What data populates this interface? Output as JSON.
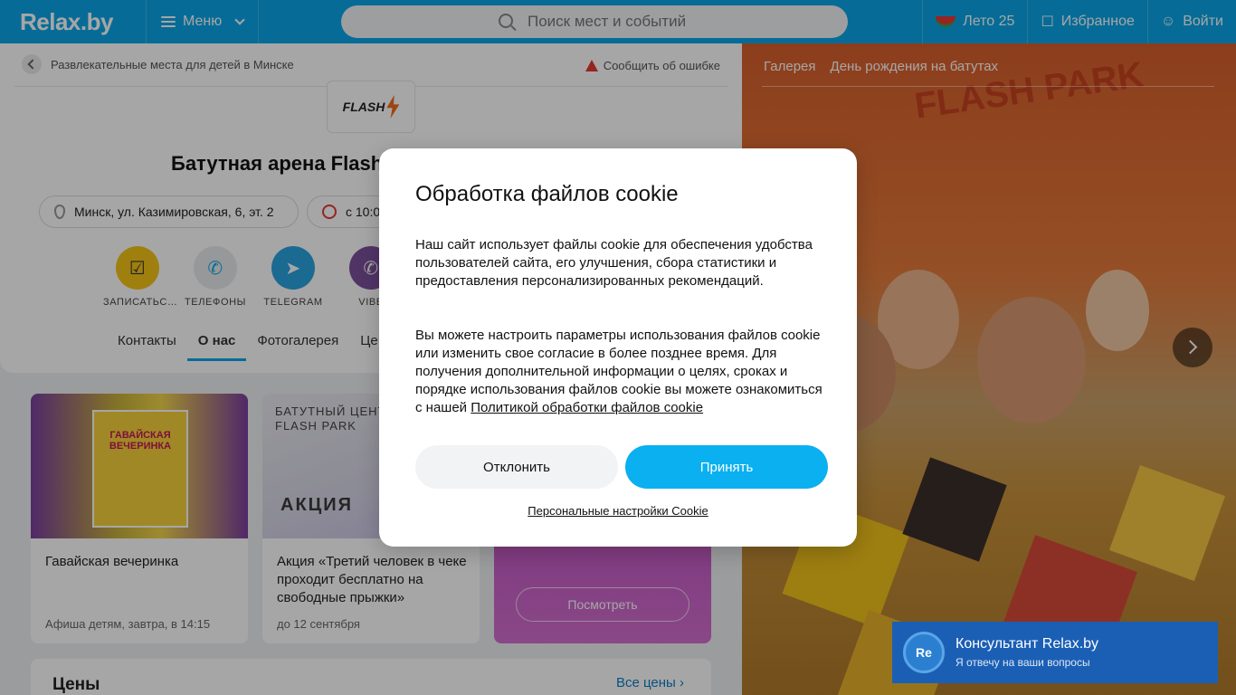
{
  "header": {
    "logo": "Relax.by",
    "menu_label": "Меню",
    "search_placeholder": "Поиск мест и событий",
    "summer_label": "Лето 25",
    "favorites_label": "Избранное",
    "login_label": "Войти"
  },
  "breadcrumb": {
    "label": "Развлекательные места для детей в Минске",
    "report_label": "Сообщить об ошибке"
  },
  "place": {
    "logo_text": "FLASH",
    "title": "Батутная арена Flash",
    "address": "Минск, ул. Казимировская, 6, эт. 2",
    "hours": "с 10:0"
  },
  "actions": [
    {
      "label": "ЗАПИСАТЬС…",
      "icon": "calendar-check-icon",
      "color": "#f5c518"
    },
    {
      "label": "ТЕЛЕФОНЫ",
      "icon": "phone-icon",
      "color": "#e8eaed"
    },
    {
      "label": "TELEGRAM",
      "icon": "telegram-icon",
      "color": "#2aa3e0"
    },
    {
      "label": "VIBE",
      "icon": "viber-icon",
      "color": "#7b519d"
    }
  ],
  "tabs": [
    "Контакты",
    "О нас",
    "Фотогалерея",
    "Це"
  ],
  "promos": [
    {
      "title": "Гавайская вечеринка",
      "date": "Афиша детям, завтра, в 14:15",
      "img_label": "ГАВАЙСКАЯ ВЕЧЕРИНКА"
    },
    {
      "title": "Акция «Третий человек в чеке проходит бесплатно на свободные прыжки»",
      "date": "до 12 сентября",
      "img_label_1": "БАТУТНЫЙ ЦЕНТ",
      "img_label_2": "FLASH PARK",
      "img_label_3": "АКЦИЯ"
    },
    {
      "button": "Посмотреть"
    }
  ],
  "prices": {
    "heading": "Цены",
    "all_link": "Все цены"
  },
  "gallery": {
    "links": [
      "Галерея",
      "День рождения на батутах"
    ],
    "brand": "FLASH PARK"
  },
  "cookie_modal": {
    "title": "Обработка файлов cookie",
    "paragraph1": "Наш сайт использует файлы cookie для обеспечения удобства пользователей сайта, его улучшения, сбора статистики и предоставления персонализированных рекомендаций.",
    "paragraph2": "Вы можете настроить параметры использования файлов cookie или изменить свое согласие в более позднее время. Для получения дополнительной информации о целях, сроках и порядке использования файлов cookie вы можете ознакомиться с нашей",
    "policy_link": "Политикой обработки файлов cookie",
    "decline": "Отклонить",
    "accept": "Принять",
    "settings": "Персональные настройки Cookie"
  },
  "consultant": {
    "avatar": "Re",
    "title": "Консультант Relax.by",
    "subtitle": "Я отвечу на ваши вопросы"
  }
}
